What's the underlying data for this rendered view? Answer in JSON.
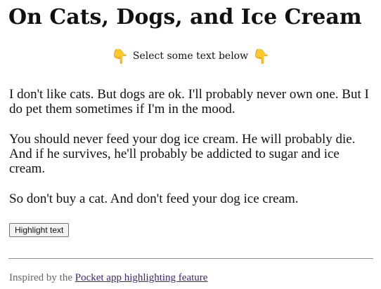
{
  "page": {
    "title": "On Cats, Dogs, and Ice Cream",
    "hint": {
      "text": "Select some text below",
      "left_icon": "pointing-down-hand-icon",
      "right_icon": "pointing-down-hand-icon",
      "icon_glyph": "👇",
      "icon_color": "#f2b533"
    },
    "paragraphs": [
      "I don't like cats. But dogs are ok. I'll probably never own one. But I do pet them sometimes if I'm in the mood.",
      "You should never feed your dog ice cream. He will probably die. And if he survives, he'll probably be addicted to sugar and ice cream.",
      "So don't buy a cat. And don't feed your dog ice cream."
    ],
    "button_label": "Highlight text",
    "footer": {
      "prefix": "Inspired by the ",
      "link_text": "Pocket app highlighting feature",
      "link_color": "#3b1f7a"
    }
  }
}
